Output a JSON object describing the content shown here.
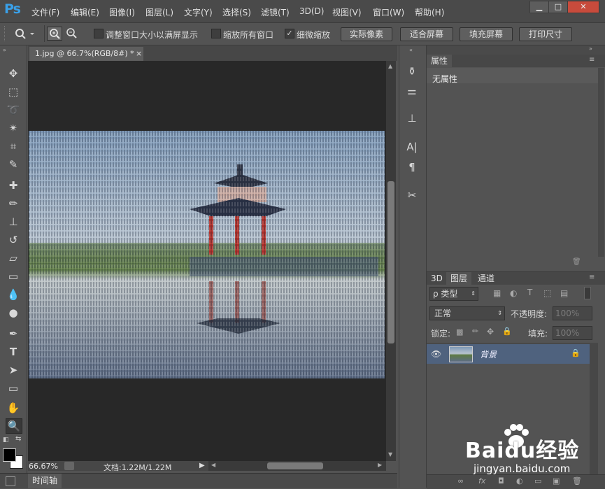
{
  "app": {
    "logo": "Ps"
  },
  "menu": [
    "文件(F)",
    "编辑(E)",
    "图像(I)",
    "图层(L)",
    "文字(Y)",
    "选择(S)",
    "滤镜(T)",
    "3D(D)",
    "视图(V)",
    "窗口(W)",
    "帮助(H)"
  ],
  "window_controls": {
    "minimize": "▁",
    "maximize": "□",
    "close": "✕"
  },
  "options": {
    "resize_windows": "调整窗口大小以满屏显示",
    "zoom_all": "缩放所有窗口",
    "scrubby_zoom": "细微缩放",
    "scrubby_checked": "✓",
    "btn_actual": "实际像素",
    "btn_fit": "适合屏幕",
    "btn_fill": "填充屏幕",
    "btn_print": "打印尺寸"
  },
  "document": {
    "tab_title": "1.jpg @ 66.7%(RGB/8#) *",
    "tab_close": "×"
  },
  "status": {
    "zoom": "66.67%",
    "doc_info": "文档:1.22M/1.22M",
    "arrow": "▶"
  },
  "timeline": {
    "label": "时间轴"
  },
  "properties": {
    "tab": "属性",
    "empty": "无属性"
  },
  "layers": {
    "tabs": [
      "3D",
      "图层",
      "通道"
    ],
    "kind": "ρ 类型",
    "blend_mode": "正常",
    "opacity_label": "不透明度:",
    "opacity_value": "100%",
    "lock_label": "锁定:",
    "fill_label": "填充:",
    "fill_value": "100%",
    "items": [
      {
        "name": "背景",
        "visible": true,
        "locked": true
      }
    ]
  },
  "watermark": {
    "brand": "Baidu经验",
    "url": "jingyan.baidu.com"
  },
  "colors": {
    "accent": "#3aa0e8",
    "selected_layer": "#4f627e",
    "canvas": "#282828",
    "panel": "#535353"
  }
}
